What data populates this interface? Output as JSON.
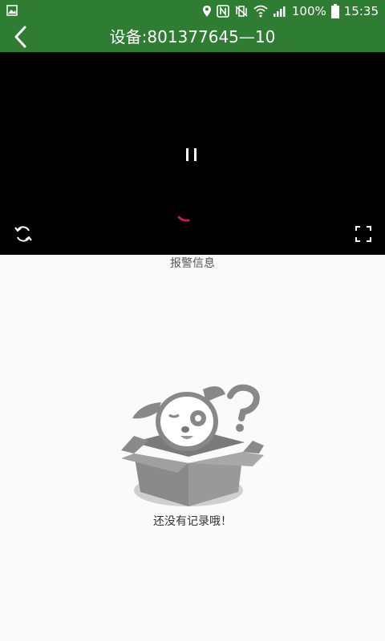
{
  "status_bar": {
    "battery_percent": "100%",
    "time": "15:35",
    "icons": [
      "image-icon",
      "location-icon",
      "nfc-icon",
      "vibrate-icon",
      "wifi-icon",
      "signal-icon",
      "battery-icon"
    ]
  },
  "header": {
    "title": "设备:801377645—10",
    "back_icon": "chevron-left-icon"
  },
  "video": {
    "state_icon": "pause-icon",
    "loading_icon": "spinner-icon",
    "rotate_icon": "rotate-icon",
    "fullscreen_icon": "fullscreen-icon"
  },
  "alarm_section": {
    "label": "报警信息",
    "empty_illustration": "empty-box-dog-illustration",
    "empty_text": "还没有记录哦！"
  },
  "colors": {
    "header_bg": "#2e7d32",
    "video_bg": "#000000",
    "page_bg": "#fafafa",
    "spinner_accent": "#c2185b"
  }
}
